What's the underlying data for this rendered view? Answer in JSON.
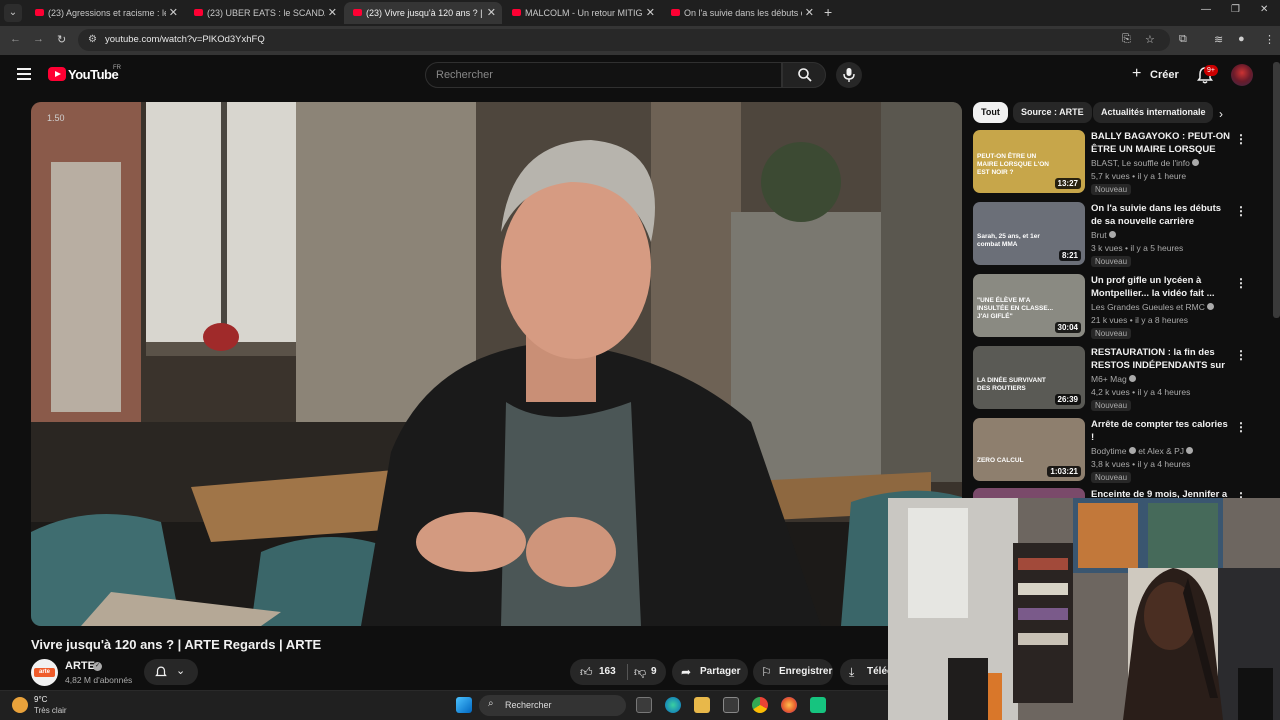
{
  "browser": {
    "tabs": [
      {
        "label": "(23) Agressions et racisme : le c",
        "active": false
      },
      {
        "label": "(23) UBER EATS : le SCANDALE",
        "active": false
      },
      {
        "label": "(23) Vivre jusqu'à 120 ans ? | AR",
        "active": true
      },
      {
        "label": "MALCOLM - Un retour MITIGÉ ?",
        "active": false
      },
      {
        "label": "On l'a suivie dans les débuts de",
        "active": false
      }
    ],
    "url": "youtube.com/watch?v=PlKOd3YxhFQ"
  },
  "youtube": {
    "logo_text": "YouTube",
    "country_code": "FR",
    "search_placeholder": "Rechercher",
    "create_label": "Créer",
    "notifications_badge": "9+"
  },
  "player": {
    "speed_overlay": "1.50"
  },
  "video": {
    "title": "Vivre jusqu'à 120 ans ? | ARTE Regards | ARTE",
    "channel_logo": "arte",
    "channel_name": "ARTE",
    "subscribers": "4,82 M d'abonnés",
    "likes": "163",
    "dislikes": "9",
    "share_label": "Partager",
    "save_label": "Enregistrer",
    "download_label": "Téléc"
  },
  "sidebar": {
    "chips": [
      {
        "label": "Tout",
        "selected": true
      },
      {
        "label": "Source : ARTE",
        "selected": false
      },
      {
        "label": "Actualités internationale",
        "selected": false
      }
    ],
    "recommendations": [
      {
        "title": "BALLY BAGAYOKO : PEUT-ON ÊTRE UN MAIRE LORSQUE L'O...",
        "channel": "BLAST, Le souffle de l'info",
        "meta": "5,7 k vues • il y a 1 heure",
        "badge": "Nouveau",
        "duration": "13:27",
        "thumb_color": "#c7a64a",
        "thumb_text": "PEUT-ON ÊTRE UN MAIRE LORSQUE L'ON EST NOIR ?"
      },
      {
        "title": "On l'a suivie dans les débuts de sa nouvelle carrière",
        "channel": "Brut",
        "meta": "3 k vues • il y a 5 heures",
        "badge": "Nouveau",
        "duration": "8:21",
        "thumb_color": "#6b6f78",
        "thumb_text": "Sarah, 25 ans, et 1er combat MMA"
      },
      {
        "title": "Un prof gifle un lycéen à Montpellier... la vidéo fait ...",
        "channel": "Les Grandes Gueules et RMC",
        "meta": "21 k vues • il y a 8 heures",
        "badge": "Nouveau",
        "duration": "30:04",
        "thumb_color": "#8a8a82",
        "thumb_text": "\"UNE ÉLÈVE M'A INSULTÉE EN CLASSE... J'AI GIFLÉ\""
      },
      {
        "title": "RESTAURATION : la fin des RESTOS INDÉPENDANTS sur ...",
        "channel": "M6+ Mag",
        "meta": "4,2 k vues • il y a 4 heures",
        "badge": "Nouveau",
        "duration": "26:39",
        "thumb_color": "#5a5a55",
        "thumb_text": "LA DINÉE SURVIVANT DES ROUTIERS"
      },
      {
        "title": "Arrête de compter tes calories !",
        "channel": "Bodytime",
        "channel_extra": "et Alex & PJ",
        "meta": "3,8 k vues • il y a 4 heures",
        "badge": "Nouveau",
        "duration": "1:03:21",
        "thumb_color": "#8e7f6e",
        "thumb_text": "ZERO CALCUL"
      },
      {
        "title": "Enceinte de 9 mois, Jennifer a",
        "thumb_color": "#7a4a6a"
      }
    ]
  },
  "taskbar": {
    "temperature": "9°C",
    "condition": "Très clair",
    "search_label": "Rechercher"
  },
  "colors": {
    "youtube_red": "#ff0033",
    "background": "#0f0f0f",
    "chip_bg": "#272727"
  }
}
